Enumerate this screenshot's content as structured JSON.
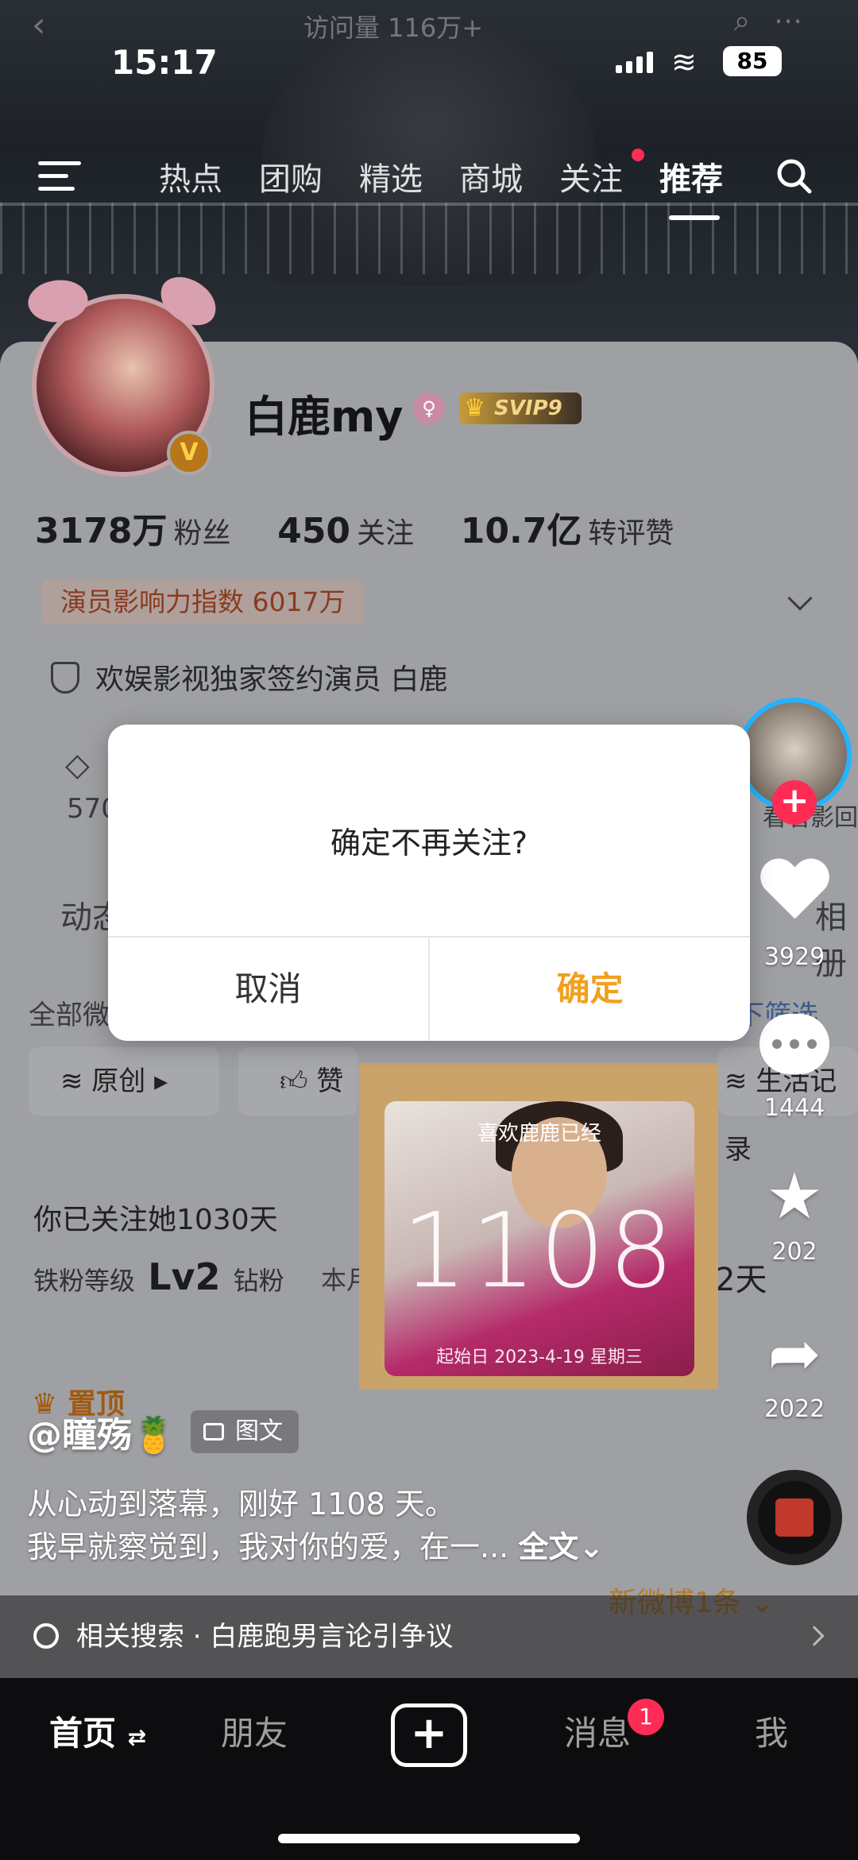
{
  "top_faded": {
    "views": "访问量 116万+"
  },
  "status_bar": {
    "time": "15:17",
    "battery": "85"
  },
  "top_nav": {
    "tabs": [
      "热点",
      "团购",
      "精选",
      "商城",
      "关注",
      "推荐"
    ],
    "active_tab": "推荐"
  },
  "profile": {
    "username": "白鹿my",
    "vip_label": "SVIP9",
    "fans_count": "3178万",
    "fans_label": "粉丝",
    "following_count": "450",
    "following_label": "关注",
    "likes_count": "10.7亿",
    "likes_label": "转评赞",
    "influence": "演员影响力指数 6017万",
    "signing": "欢娱影视独家签约演员 白鹿",
    "partial_570": "570",
    "partial_dong": "动态",
    "partial_all": "全部微",
    "partial_filter": "下筛选",
    "partial_photos": "相册",
    "row_original": "原创",
    "row_like": "赞",
    "row_life": "生活记录",
    "followed_days": "你已关注她1030天",
    "fans_level_label": "铁粉等级",
    "fans_level": "Lv2",
    "fans_level_suffix": "钻粉",
    "partial_this": "本月",
    "partial_days": "2天",
    "pinned": "置顶"
  },
  "photo_card": {
    "caption": "喜欢鹿鹿已经",
    "days": "1108",
    "start_date": "起始日  2023-4-19 星期三"
  },
  "side_actions": {
    "side_avatar_caption": "看看影回",
    "likes": "3929",
    "comments": "1444",
    "favorites": "202",
    "shares": "2022"
  },
  "post": {
    "author": "@瞳殇🍍",
    "tag": "图文",
    "line1": "从心动到落幕，刚好 1108 天。",
    "line2": "我早就察觉到，我对你的爱，在一... ",
    "more": "全文⌄",
    "weibo_new": "新微博1条 ⌄"
  },
  "related_search": "相关搜索 · 白鹿跑男言论引争议",
  "tab_bar": {
    "home": "首页",
    "friends": "朋友",
    "messages": "消息",
    "messages_badge": "1",
    "me": "我"
  },
  "dialog": {
    "message": "确定不再关注?",
    "cancel": "取消",
    "confirm": "确定"
  },
  "colors": {
    "accent_confirm": "#f0a020",
    "badge_red": "#fe2c55",
    "dim_overlay": "#9fa0a3"
  }
}
